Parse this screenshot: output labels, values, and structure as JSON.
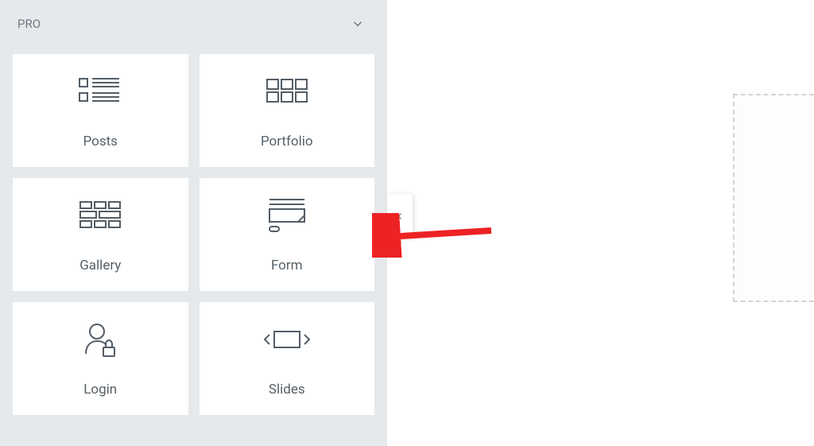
{
  "sidebar": {
    "category_label": "PRO",
    "widgets": [
      {
        "name": "posts",
        "label": "Posts",
        "icon": "posts-icon"
      },
      {
        "name": "portfolio",
        "label": "Portfolio",
        "icon": "portfolio-icon"
      },
      {
        "name": "gallery",
        "label": "Gallery",
        "icon": "gallery-icon"
      },
      {
        "name": "form",
        "label": "Form",
        "icon": "form-icon"
      },
      {
        "name": "login",
        "label": "Login",
        "icon": "login-icon"
      },
      {
        "name": "slides",
        "label": "Slides",
        "icon": "slides-icon"
      }
    ]
  },
  "colors": {
    "panel_bg": "#e6e9ec",
    "card_bg": "#ffffff",
    "text": "#556068",
    "text_light": "#6d7882",
    "icon_stroke": "#545d66",
    "arrow": "#ed2224"
  }
}
